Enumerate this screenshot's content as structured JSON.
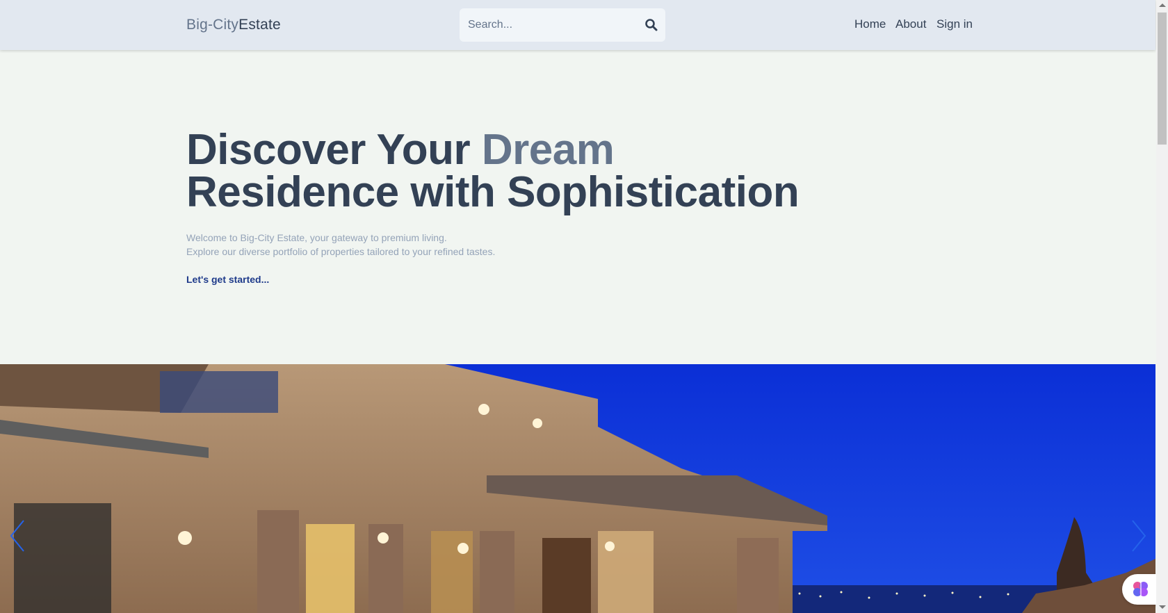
{
  "header": {
    "logo_part1": "Big-City",
    "logo_part2": "Estate",
    "search_placeholder": "Search...",
    "nav": [
      "Home",
      "About",
      "Sign in"
    ]
  },
  "hero": {
    "title_line1_a": "Discover Your ",
    "title_line1_b": "Dream",
    "title_line2": "Residence with Sophistication",
    "subtitle_line1": "Welcome to Big-City Estate, your gateway to premium living.",
    "subtitle_line2": "Explore our diverse portfolio of properties tailored to your refined tastes.",
    "cta": "Let's get started..."
  },
  "colors": {
    "header_bg": "#e2e8f0",
    "page_bg": "#f1f5f1",
    "title": "#334155",
    "accent": "#64748b",
    "cta": "#1e3a8a"
  },
  "banner": {
    "icons": [
      "chevron-left-icon",
      "chevron-right-icon",
      "brain-icon"
    ]
  }
}
